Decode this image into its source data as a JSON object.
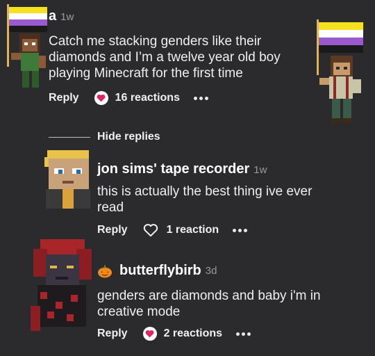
{
  "comments": [
    {
      "username": "a",
      "time": "1w",
      "text_lines": [
        "Catch me stacking genders like their",
        "diamonds and I’m a twelve year old boy",
        "playing Minecraft for the first time"
      ],
      "reply_label": "Reply",
      "reactions": "16 reactions",
      "reaction_icon": "heart-filled-icon"
    },
    {
      "username": "jon sims' tape recorder",
      "time": "1w",
      "text_lines": [
        "this is actually the best thing ive ever",
        "read"
      ],
      "reply_label": "Reply",
      "reactions": "1 reaction",
      "reaction_icon": "heart-outline-icon"
    },
    {
      "username": "butterflybirb",
      "time": "3d",
      "text_lines": [
        "genders are diamonds and baby i'm in",
        "creative mode"
      ],
      "reply_label": "Reply",
      "reactions": "2 reactions",
      "reaction_icon": "heart-filled-icon",
      "name_emoji": "pumpkin-icon"
    }
  ],
  "hide_replies_label": "Hide replies",
  "colors": {
    "background": "#2b2b2d",
    "heart": "#e0245e",
    "flag_yellow": "#f5e11d",
    "flag_white": "#ffffff",
    "flag_purple": "#9b59d0",
    "flag_black": "#1a1a1a"
  }
}
